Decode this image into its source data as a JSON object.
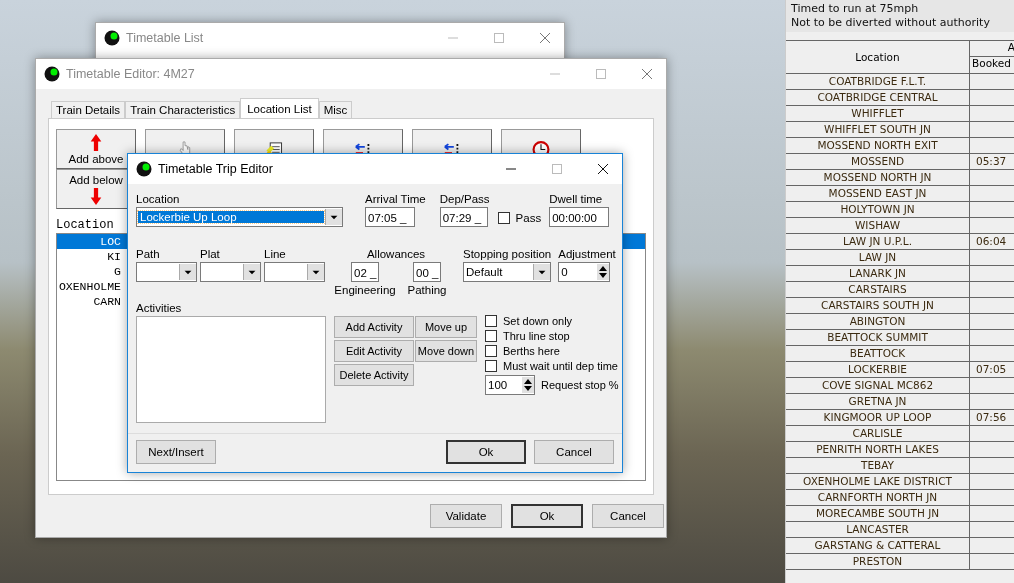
{
  "timetable_list_window": {
    "title": "Timetable List"
  },
  "editor_window": {
    "title": "Timetable Editor: 4M27",
    "tabs": [
      {
        "label": "Train Details",
        "selected": false
      },
      {
        "label": "Train Characteristics",
        "selected": false
      },
      {
        "label": "Location List",
        "selected": true
      },
      {
        "label": "Misc",
        "selected": false
      }
    ],
    "toolbar": [
      {
        "kind": "add_above",
        "label": "Add above"
      },
      {
        "kind": "hand"
      },
      {
        "kind": "document"
      },
      {
        "kind": "insert"
      },
      {
        "kind": "insert"
      },
      {
        "kind": "clock"
      }
    ],
    "add_below": {
      "label": "Add below"
    },
    "list_heading": "Location",
    "locations": [
      {
        "text": "LOC",
        "selected": true
      },
      {
        "text": "KI",
        "selected": false
      },
      {
        "text": "G",
        "selected": false
      },
      {
        "text": "OXENHOLME",
        "selected": false
      },
      {
        "text": "CARN",
        "selected": false
      }
    ],
    "buttons": [
      "Validate",
      "Ok",
      "Cancel"
    ]
  },
  "trip_editor": {
    "title": "Timetable Trip Editor",
    "location": {
      "label": "Location",
      "value": "Lockerbie Up Loop"
    },
    "arrival": {
      "label": "Arrival Time",
      "value": "07:05 _"
    },
    "dep_pass": {
      "label": "Dep/Pass",
      "value": "07:29 _"
    },
    "pass": {
      "label": "Pass",
      "checked": false
    },
    "dwell": {
      "label": "Dwell time",
      "value": "00:00:00"
    },
    "path": {
      "label": "Path"
    },
    "plat": {
      "label": "Plat"
    },
    "line": {
      "label": "Line"
    },
    "allowances": {
      "label": "Allowances",
      "engineering": {
        "value": "02 _",
        "label": "Engineering"
      },
      "pathing": {
        "value": "00 _",
        "label": "Pathing"
      }
    },
    "stopping_position": {
      "label": "Stopping position",
      "value": "Default"
    },
    "adjustment": {
      "label": "Adjustment",
      "value": "0"
    },
    "activities": {
      "label": "Activities"
    },
    "activity_buttons": [
      "Add Activity",
      "Move up",
      "Edit Activity",
      "Move down",
      "Delete Activity"
    ],
    "options": [
      {
        "label": "Set down only",
        "checked": false
      },
      {
        "label": "Thru line stop",
        "checked": false
      },
      {
        "label": "Berths here",
        "checked": false
      },
      {
        "label": "Must wait until dep time",
        "checked": false
      }
    ],
    "request_stop": {
      "value": "100",
      "label": "Request stop %"
    },
    "next_button": "Next/Insert",
    "ok_button": "Ok",
    "cancel_button": "Cancel"
  },
  "right_page": {
    "notes": [
      "Timed to run at 75mph",
      "Not to be diverted without authority"
    ],
    "columns": [
      "Location",
      "A"
    ],
    "subcolumns": [
      "Booked"
    ],
    "rows": [
      {
        "location": "COATBRIDGE F.L.T."
      },
      {
        "location": "COATBRIDGE CENTRAL"
      },
      {
        "location": "WHIFFLET"
      },
      {
        "location": "WHIFFLET SOUTH JN"
      },
      {
        "location": "MOSSEND NORTH EXIT"
      },
      {
        "location": "MOSSEND",
        "booked": "05:37"
      },
      {
        "location": "MOSSEND NORTH JN"
      },
      {
        "location": "MOSSEND EAST JN"
      },
      {
        "location": "HOLYTOWN JN"
      },
      {
        "location": "WISHAW"
      },
      {
        "location": "LAW JN U.P.L.",
        "booked": "06:04"
      },
      {
        "location": "LAW JN"
      },
      {
        "location": "LANARK JN"
      },
      {
        "location": "CARSTAIRS"
      },
      {
        "location": "CARSTAIRS SOUTH JN"
      },
      {
        "location": "ABINGTON"
      },
      {
        "location": "BEATTOCK SUMMIT"
      },
      {
        "location": "BEATTOCK"
      },
      {
        "location": "LOCKERBIE",
        "booked": "07:05"
      },
      {
        "location": "COVE SIGNAL MC862"
      },
      {
        "location": "GRETNA JN"
      },
      {
        "location": "KINGMOOR UP LOOP",
        "booked": "07:56"
      },
      {
        "location": "CARLISLE"
      },
      {
        "location": "PENRITH NORTH LAKES"
      },
      {
        "location": "TEBAY"
      },
      {
        "location": "OXENHOLME LAKE DISTRICT"
      },
      {
        "location": "CARNFORTH NORTH JN"
      },
      {
        "location": "MORECAMBE SOUTH JN"
      },
      {
        "location": "LANCASTER"
      },
      {
        "location": "GARSTANG & CATTERAL"
      },
      {
        "location": "PRESTON"
      }
    ]
  }
}
